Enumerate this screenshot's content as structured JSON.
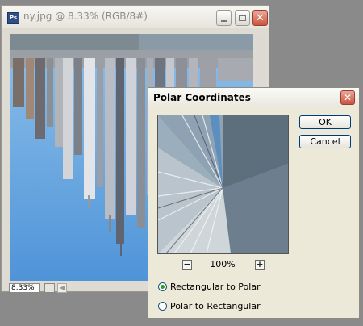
{
  "document_window": {
    "app_icon": "Ps",
    "title": "ny.jpg @ 8.33% (RGB/8#)",
    "icons": [
      "photoshop-icon",
      "minimize-icon",
      "maximize-icon",
      "close-icon",
      "navigator-icon",
      "scroll-left-arrow-icon"
    ],
    "status": {
      "zoom": "8.33%"
    }
  },
  "dialog": {
    "title": "Polar Coordinates",
    "ok_label": "OK",
    "cancel_label": "Cancel",
    "zoom": "100%",
    "zoom_minus": "−",
    "zoom_plus": "+",
    "options": [
      {
        "label": "Rectangular to Polar",
        "selected": true
      },
      {
        "label": "Polar to Rectangular",
        "selected": false
      }
    ]
  },
  "colors": {
    "accent_close": "#c8563f",
    "radio_selected": "#21a121",
    "sky": "#6aa3dc"
  }
}
